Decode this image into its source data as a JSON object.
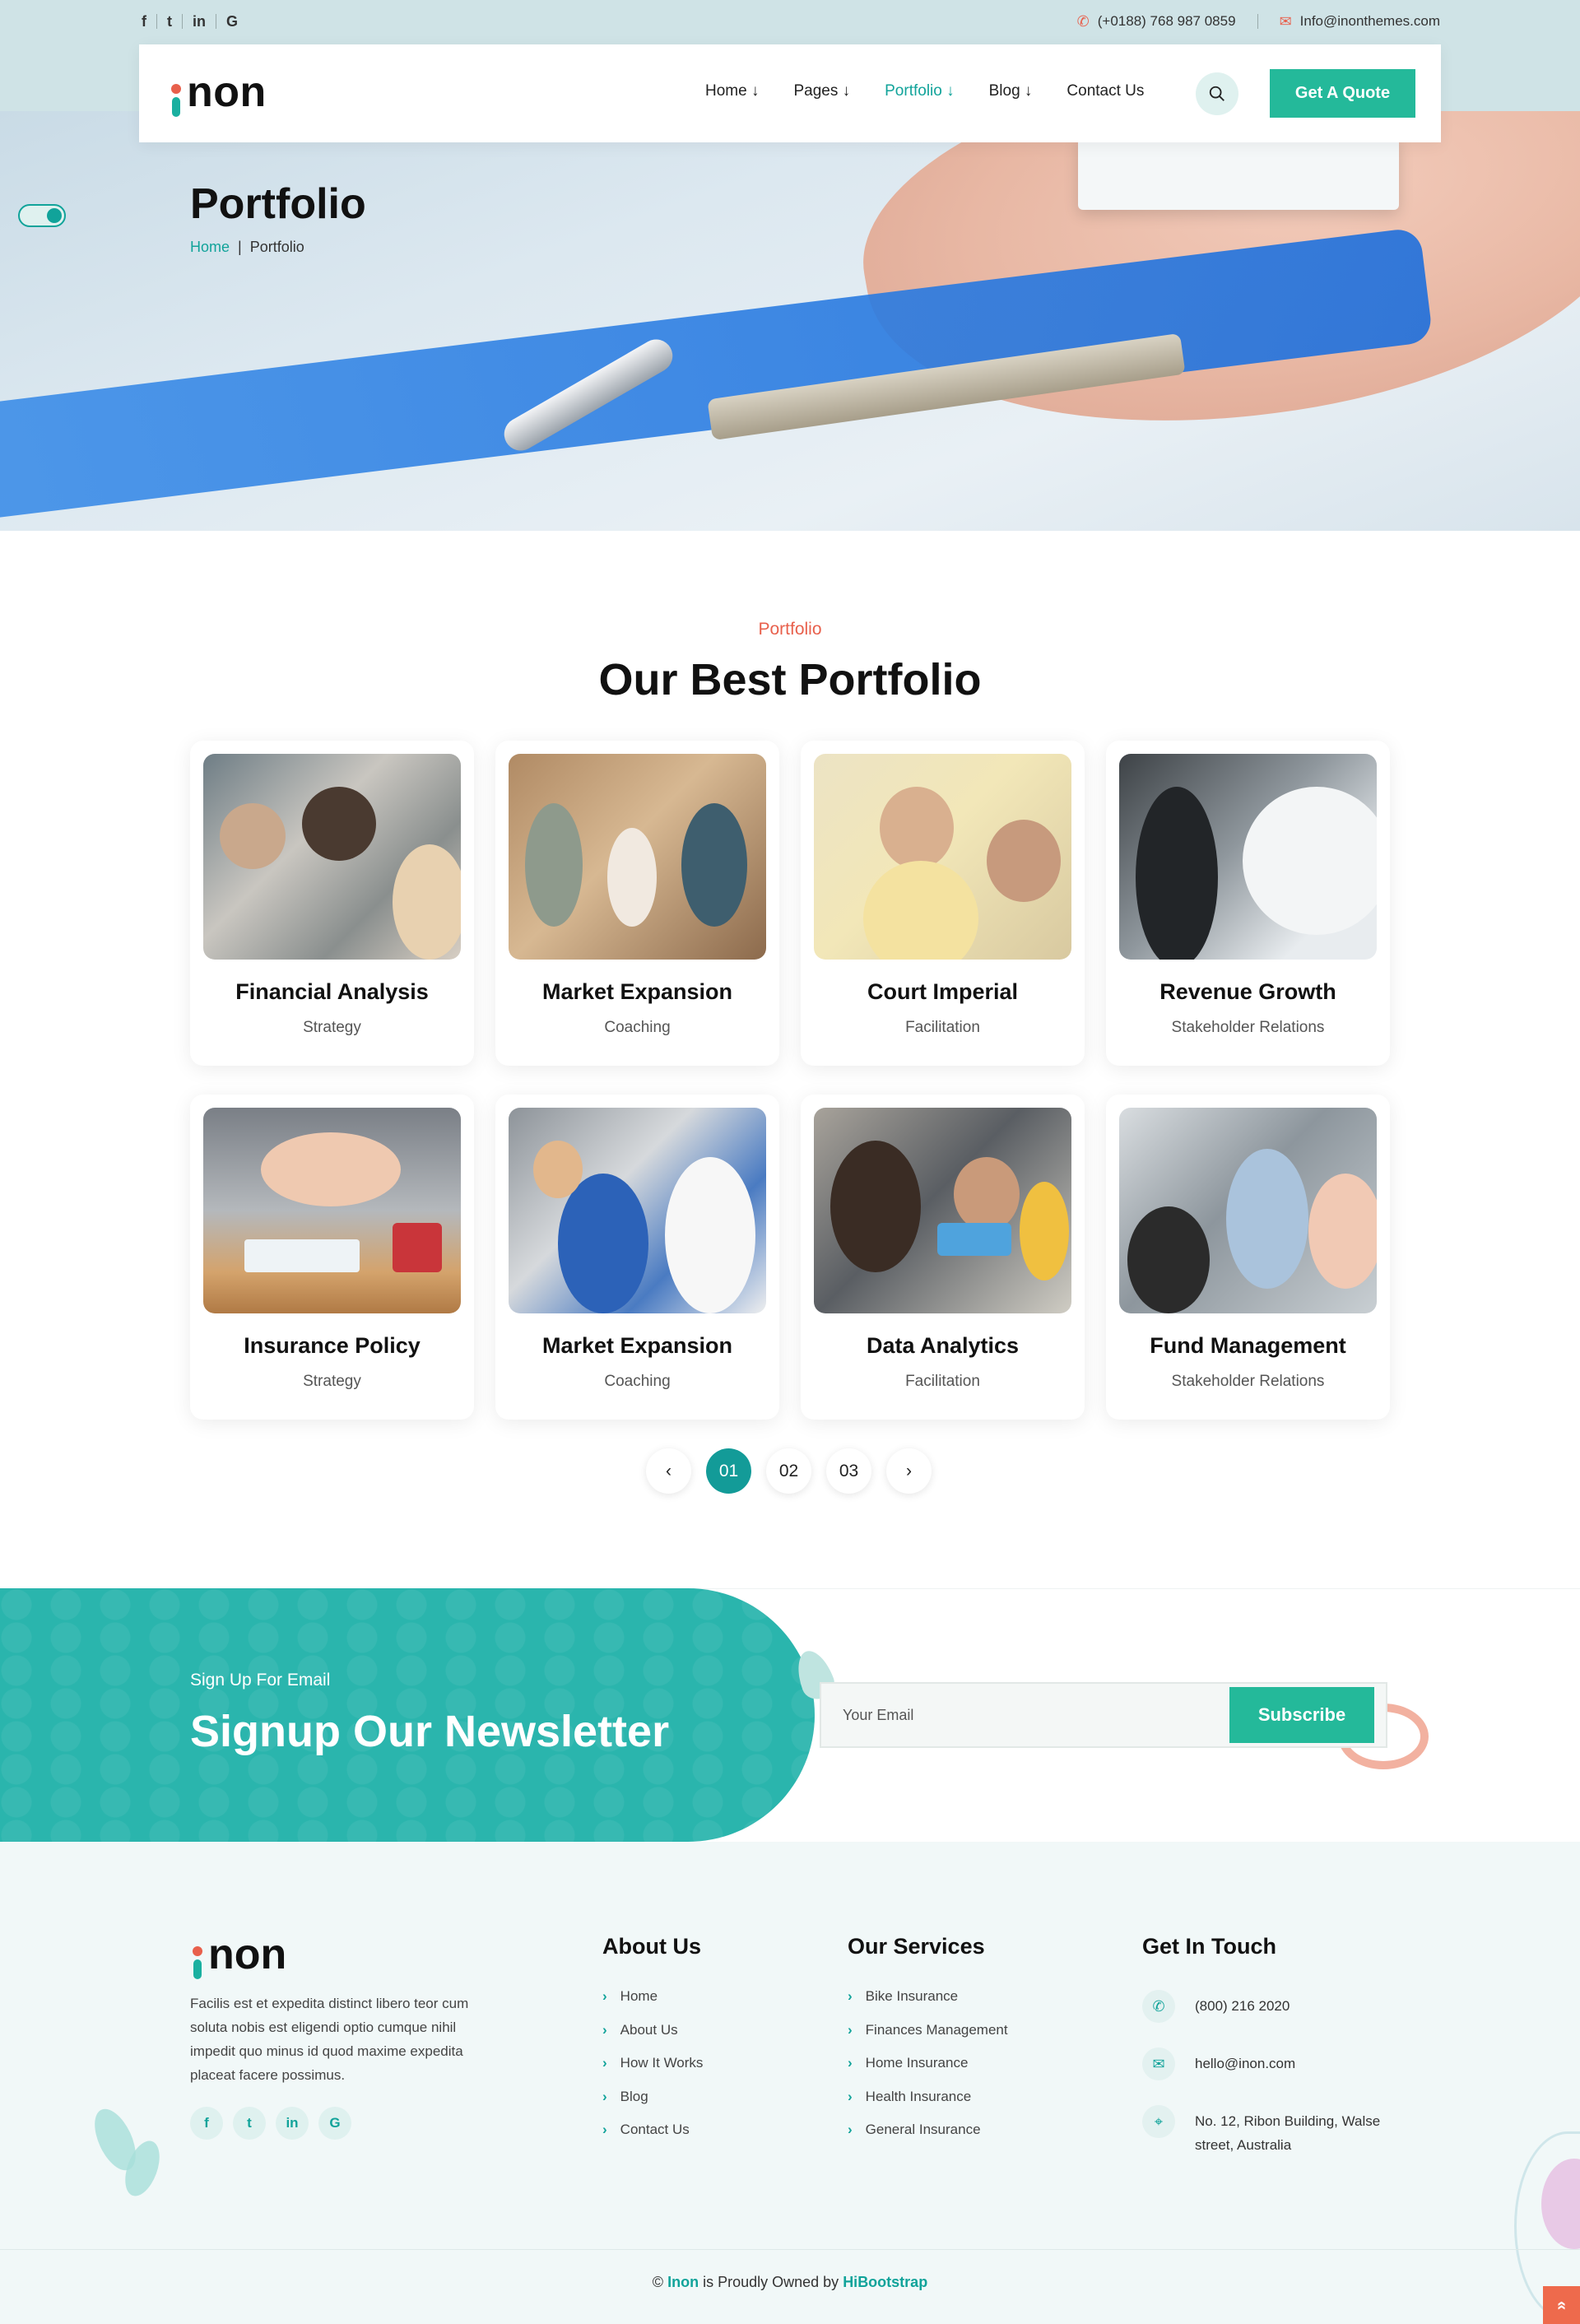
{
  "topbar": {
    "social": [
      "f",
      "t",
      "in",
      "G"
    ],
    "phone": "(+0188) 768 987 0859",
    "email": "Info@inonthemes.com"
  },
  "nav": {
    "logo": "non",
    "items": [
      {
        "label": "Home ↓"
      },
      {
        "label": "Pages ↓"
      },
      {
        "label": "Portfolio ↓"
      },
      {
        "label": "Blog ↓"
      },
      {
        "label": "Contact Us"
      }
    ],
    "active_index": 2,
    "cta": "Get A Quote"
  },
  "hero": {
    "title": "Portfolio",
    "breadcrumb": {
      "home": "Home",
      "sep": "|",
      "current": "Portfolio"
    }
  },
  "portfolio": {
    "subtitle": "Portfolio",
    "title": "Our Best Portfolio",
    "cards": [
      {
        "name": "Financial Analysis",
        "category": "Strategy"
      },
      {
        "name": "Market Expansion",
        "category": "Coaching"
      },
      {
        "name": "Court Imperial",
        "category": "Facilitation"
      },
      {
        "name": "Revenue Growth",
        "category": "Stakeholder Relations"
      },
      {
        "name": "Insurance Policy",
        "category": "Strategy"
      },
      {
        "name": "Market Expansion",
        "category": "Coaching"
      },
      {
        "name": "Data Analytics",
        "category": "Facilitation"
      },
      {
        "name": "Fund Management",
        "category": "Stakeholder Relations"
      }
    ],
    "pagination": {
      "prev": "‹",
      "pages": [
        "01",
        "02",
        "03"
      ],
      "next": "›",
      "current": "01"
    }
  },
  "newsletter": {
    "subtitle": "Sign Up For Email",
    "title": "Signup Our Newsletter",
    "placeholder": "Your Email",
    "button": "Subscribe"
  },
  "footer": {
    "logo": "non",
    "about": "Facilis est et expedita distinct libero teor cum soluta nobis est eligendi optio cumque nihil impedit quo minus id quod maxime expedita placeat facere possimus.",
    "social": [
      "f",
      "t",
      "in",
      "G"
    ],
    "about_col": {
      "title": "About Us",
      "links": [
        "Home",
        "About Us",
        "How It Works",
        "Blog",
        "Contact Us"
      ]
    },
    "services_col": {
      "title": "Our Services",
      "links": [
        "Bike Insurance",
        "Finances Management",
        "Home Insurance",
        "Health Insurance",
        "General Insurance"
      ]
    },
    "contact_col": {
      "title": "Get In Touch",
      "phone": "(800) 216 2020",
      "email": "hello@inon.com",
      "address": "No. 12, Ribon Building, Walse street, Australia"
    },
    "copyright": {
      "prefix": "©",
      "brand": "Inon",
      "middle": "is Proudly Owned by",
      "owner": "HiBootstrap"
    }
  },
  "colors": {
    "accent": "#11a39a",
    "cta": "#24b99a",
    "highlight": "#e8604c",
    "newsletter": "#2ab5ad"
  }
}
